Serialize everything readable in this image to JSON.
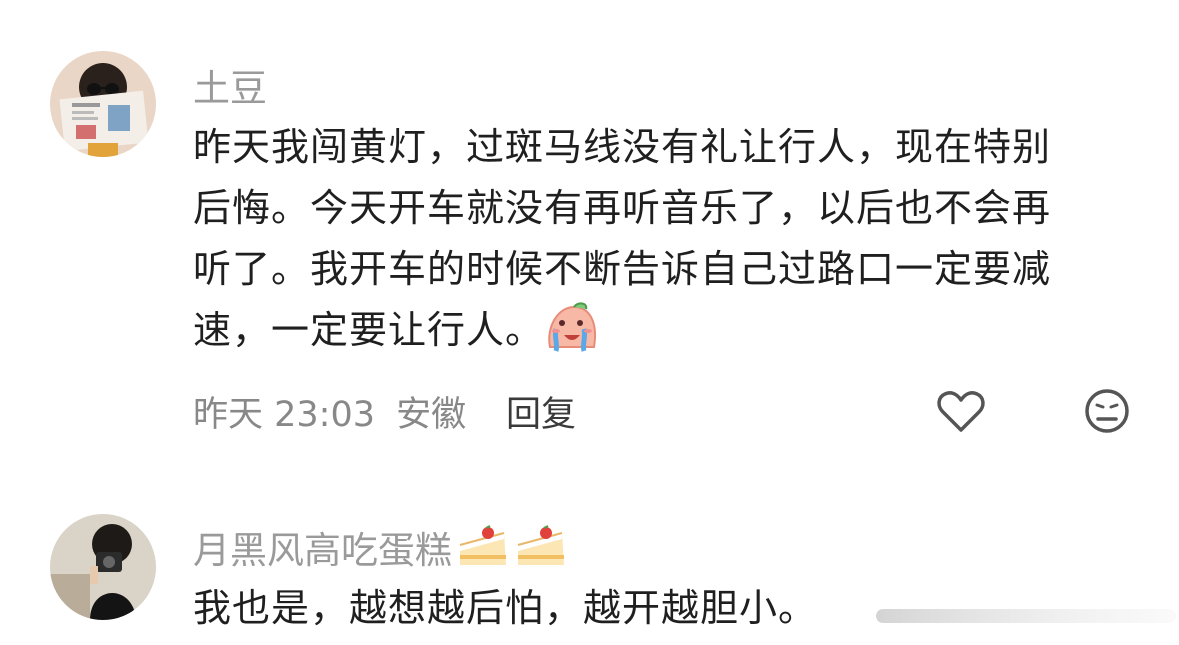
{
  "comments": [
    {
      "username": "土豆",
      "avatar": "avatar-reading-newspaper",
      "lines": [
        "昨天我闯黄灯，过斑马线没有礼让行人，现在特别",
        "后悔。今天开车就没有再听音乐了，以后也不会再",
        "听了。我开车的时候不断告诉自己过路口一定要减",
        "速，一定要让行人。"
      ],
      "trailing_emoji": "crying-face-emoji",
      "time": "昨天 23:03",
      "location": "安徽",
      "reply_label": "回复",
      "like_icon": "heart-outline-icon",
      "dislike_icon": "neutral-face-icon"
    },
    {
      "username": "月黑风高吃蛋糕",
      "username_emojis": [
        "cake-icon",
        "cake-icon"
      ],
      "avatar": "avatar-camera-selfie",
      "lines": [
        "我也是，越想越后怕，越开越胆小。"
      ]
    }
  ],
  "colors": {
    "username": "#9a9a9a",
    "body": "#1f1f1f",
    "meta": "#888888",
    "icon": "#555555"
  }
}
